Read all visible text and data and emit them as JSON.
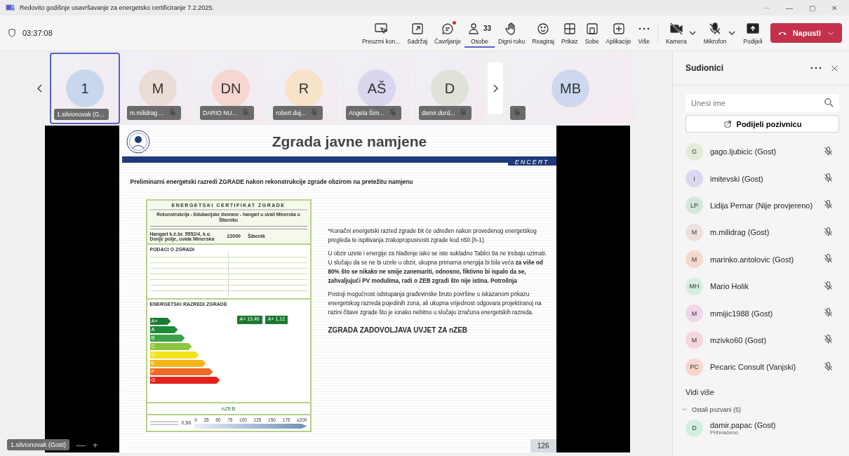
{
  "window": {
    "title": "Redovito godišnje usavršavanje za energetsko certificiranje 7.2.2025.",
    "controls": [
      "···",
      "—",
      "▢",
      "✕"
    ]
  },
  "meeting": {
    "duration": "03:37:08"
  },
  "toolbar": [
    {
      "label": "Preuzmi kon...",
      "selected": false,
      "notification": false
    },
    {
      "label": "Sadržaj",
      "selected": false,
      "notification": false
    },
    {
      "label": "Čavrljanje",
      "selected": false,
      "notification": true
    },
    {
      "label": "Osobe",
      "count": "33",
      "selected": true,
      "notification": false
    },
    {
      "label": "Digni ruku",
      "selected": false,
      "notification": false
    },
    {
      "label": "Reagiraj",
      "selected": false,
      "notification": false
    },
    {
      "label": "Prikaz",
      "selected": false,
      "notification": false
    },
    {
      "label": "Sobe",
      "selected": false,
      "notification": false
    },
    {
      "label": "Aplikacije",
      "selected": false,
      "notification": false
    },
    {
      "label": "Više",
      "selected": false,
      "notification": false
    }
  ],
  "devices": [
    {
      "label": "Kamera",
      "dropdown": true
    },
    {
      "label": "Mikrofon",
      "dropdown": true
    },
    {
      "label": "Podijeli",
      "dropdown": false
    }
  ],
  "leave_button": {
    "label": "Napusti"
  },
  "tiles": [
    {
      "initials": "1",
      "name": "1.silvionovak (G...",
      "selected": true,
      "muted": false,
      "color": "#c9d7ee"
    },
    {
      "initials": "M",
      "name": "m.milidrag ...",
      "selected": false,
      "muted": true,
      "color": "#ecdcd6"
    },
    {
      "initials": "DN",
      "name": "DARIO NU...",
      "selected": false,
      "muted": true,
      "color": "#f6d6d0"
    },
    {
      "initials": "R",
      "name": "robert.duj...",
      "selected": false,
      "muted": true,
      "color": "#f8e2c8"
    },
    {
      "initials": "AŠ",
      "name": "Angela Šim...",
      "selected": false,
      "muted": true,
      "color": "#d9d6ee"
    },
    {
      "initials": "D",
      "name": "damir.durd...",
      "selected": false,
      "muted": true,
      "color": "#dfe2d9"
    },
    {
      "initials": "MB",
      "selected": false,
      "muted": true,
      "color": "#cdd8ee"
    }
  ],
  "slide": {
    "title": "Zgrada javne namjene",
    "banner": "ENCERT",
    "subtitle": "Preliminarni energetski razredi ZGRADE nakon rekonstrukcije zgrade  obzirom na pretežitu namjenu",
    "certificate": {
      "title": "ENERGETSKI CERTIFIKAT ZGRADE",
      "building": "Rekonstrukcija - Edukacijske dvorane - hangari u uvali Minerska u Šibeniku",
      "address": "Hangari k.č.br. 5552/4, k.o. Donje polje, uvala Minerska",
      "postcode": "22000",
      "city": "Šibenik",
      "data_heading": "PODACI O ZGRADI",
      "classes_heading": "ENERGETSKI RAZREDI ZGRADE",
      "classes": [
        {
          "label": "A+",
          "color": "#1a7a32"
        },
        {
          "label": "A",
          "color": "#1e8a3a"
        },
        {
          "label": "B",
          "color": "#3aa446"
        },
        {
          "label": "C",
          "color": "#8cc63e"
        },
        {
          "label": "D",
          "color": "#f2e21c"
        },
        {
          "label": "E",
          "color": "#f5b41a"
        },
        {
          "label": "F",
          "color": "#ee6a25"
        },
        {
          "label": "G",
          "color": "#e2231a"
        }
      ],
      "ratings": [
        "A+  13,46",
        "A+  1,12"
      ],
      "nzeb": "nZEB",
      "emission": "0,56",
      "scale": [
        "0",
        "25",
        "50",
        "75",
        "100",
        "125",
        "150",
        "175",
        "≥200"
      ]
    },
    "paragraphs": [
      "*Konačni energetski razred zgrade bit će određen nakon provedenog energetskog pregleda te ispitivanja zrakopropusnosti zgrade kod n50 (h-1).",
      "U obzir uzete i energije za hlađenje iako se iste sukladno Tablici 9a ne trebaju uzimati. U slučaju da se ne bi uzele u obzir, ukupna primarna energija bi bila veća **za više od 80% što se nikako ne smije zanemariti, odnosno, fiktivno bi ispalo da se, zahvaljujući PV modulima, radi o ZEB zgradi što nije istina. Potrošnja**",
      "Postoji mogućnost odstupanja građevinske bruto površine u iskazanom prikazu energetskog razreda pojedinih zona, ali ukupna vrijednost odgovara projektiranoj na razini čitave zgrade što je ionako nebitno u slučaju izračuna energetskih razreda."
    ],
    "conclusion": "ZGRADA ZADOVOLJAVA UVJET ZA nZEB",
    "page": "126"
  },
  "presenter": {
    "name": "1.silvionovak (Gost)",
    "zoom_out": "—",
    "zoom_in": "+"
  },
  "sidebar": {
    "title": "Sudionici",
    "search": {
      "placeholder": "Unesi ime"
    },
    "share_button": "Podijeli pozivnicu",
    "participants": [
      {
        "initials": "G",
        "name": "gago.ljubicic (Gost)",
        "color": "#e3ecd9",
        "muted": true
      },
      {
        "initials": "I",
        "name": "imitevski (Gost)",
        "color": "#dcd8f0",
        "muted": true
      },
      {
        "initials": "LP",
        "name": "Lidija Pernar (Nije provjereno)",
        "color": "#d2e8dc",
        "muted": true
      },
      {
        "initials": "M",
        "name": "m.milidrag (Gost)",
        "color": "#eee0dc",
        "muted": true
      },
      {
        "initials": "M",
        "name": "marinko.antolovic (Gost)",
        "color": "#f6d8cc",
        "muted": true
      },
      {
        "initials": "MH",
        "name": "Mario Holik",
        "color": "#d4efe0",
        "muted": true
      },
      {
        "initials": "M",
        "name": "mmijic1988 (Gost)",
        "color": "#efd6ea",
        "muted": true
      },
      {
        "initials": "M",
        "name": "mzivko60 (Gost)",
        "color": "#f6d6dc",
        "muted": true
      },
      {
        "initials": "PC",
        "name": "Pecaric Consult (Vanjski)",
        "color": "#f8d6cc",
        "muted": true
      }
    ],
    "see_more": "Vidi više",
    "invited": {
      "label": "Ostali pozvani (5)",
      "expanded": true,
      "people": [
        {
          "initials": "D",
          "name": "damir.papac (Gost)",
          "status": "Prihvaćeno",
          "color": "#d4efe0"
        }
      ]
    }
  }
}
